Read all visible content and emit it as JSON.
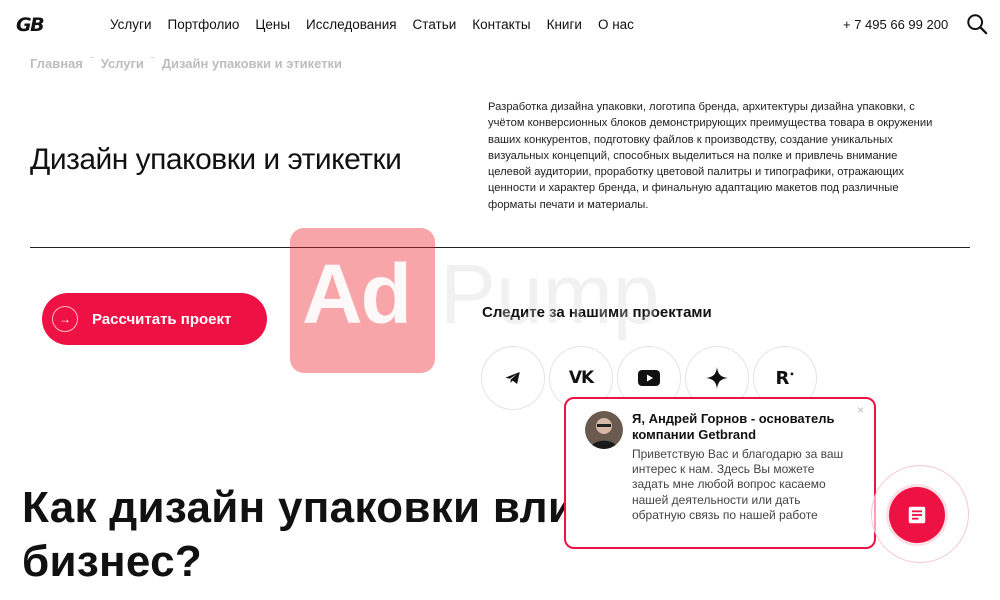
{
  "header": {
    "logo": "GB",
    "nav": [
      "Услуги",
      "Портфолио",
      "Цены",
      "Исследования",
      "Статьи",
      "Контакты",
      "Книги",
      "О нас"
    ],
    "phone": "+ 7 495 66 99 200",
    "search_icon": "search-icon"
  },
  "breadcrumb": {
    "items": [
      "Главная",
      "Услуги",
      "Дизайн упаковки и этикетки"
    ],
    "separator": "⁻"
  },
  "hero": {
    "title": "Дизайн упаковки и этикетки",
    "description": "Разработка дизайна упаковки, логотипа бренда, архитектуры дизайна упаковки, с учётом конверсионных блоков демонстрирующих преимущества товара в окружении ваших конкурентов, подготовку файлов к производству, создание уникальных визуальных концепций, способных выделиться на полке и привлечь внимание целевой аудитории, проработку цветовой палитры и типографики, отражающих ценности и характер бренда, и финальную адаптацию макетов под различные форматы печати и материалы."
  },
  "cta": {
    "label": "Рассчитать проект",
    "icon": "arrow-right-icon",
    "color": "#ee1144"
  },
  "social": {
    "title": "Следите за нашими проектами",
    "icons": [
      "telegram-icon",
      "vk-icon",
      "youtube-icon",
      "sparkle-icon",
      "r-icon"
    ]
  },
  "section": {
    "heading_line1": "Как дизайн упаковки вли",
    "heading_line2": "бизнес?"
  },
  "watermark": {
    "brand_a": "Ad",
    "brand_b": "Pump"
  },
  "chat": {
    "name": "Я, Андрей Горнов - основатель компании Getbrand",
    "message": "Приветствую Вас и благодарю за ваш интерес к нам. Здесь Вы можете задать мне любой вопрос касаемо нашей деятельности или дать обратную связь по нашей работе",
    "close": "×",
    "accent": "#ee1144"
  }
}
